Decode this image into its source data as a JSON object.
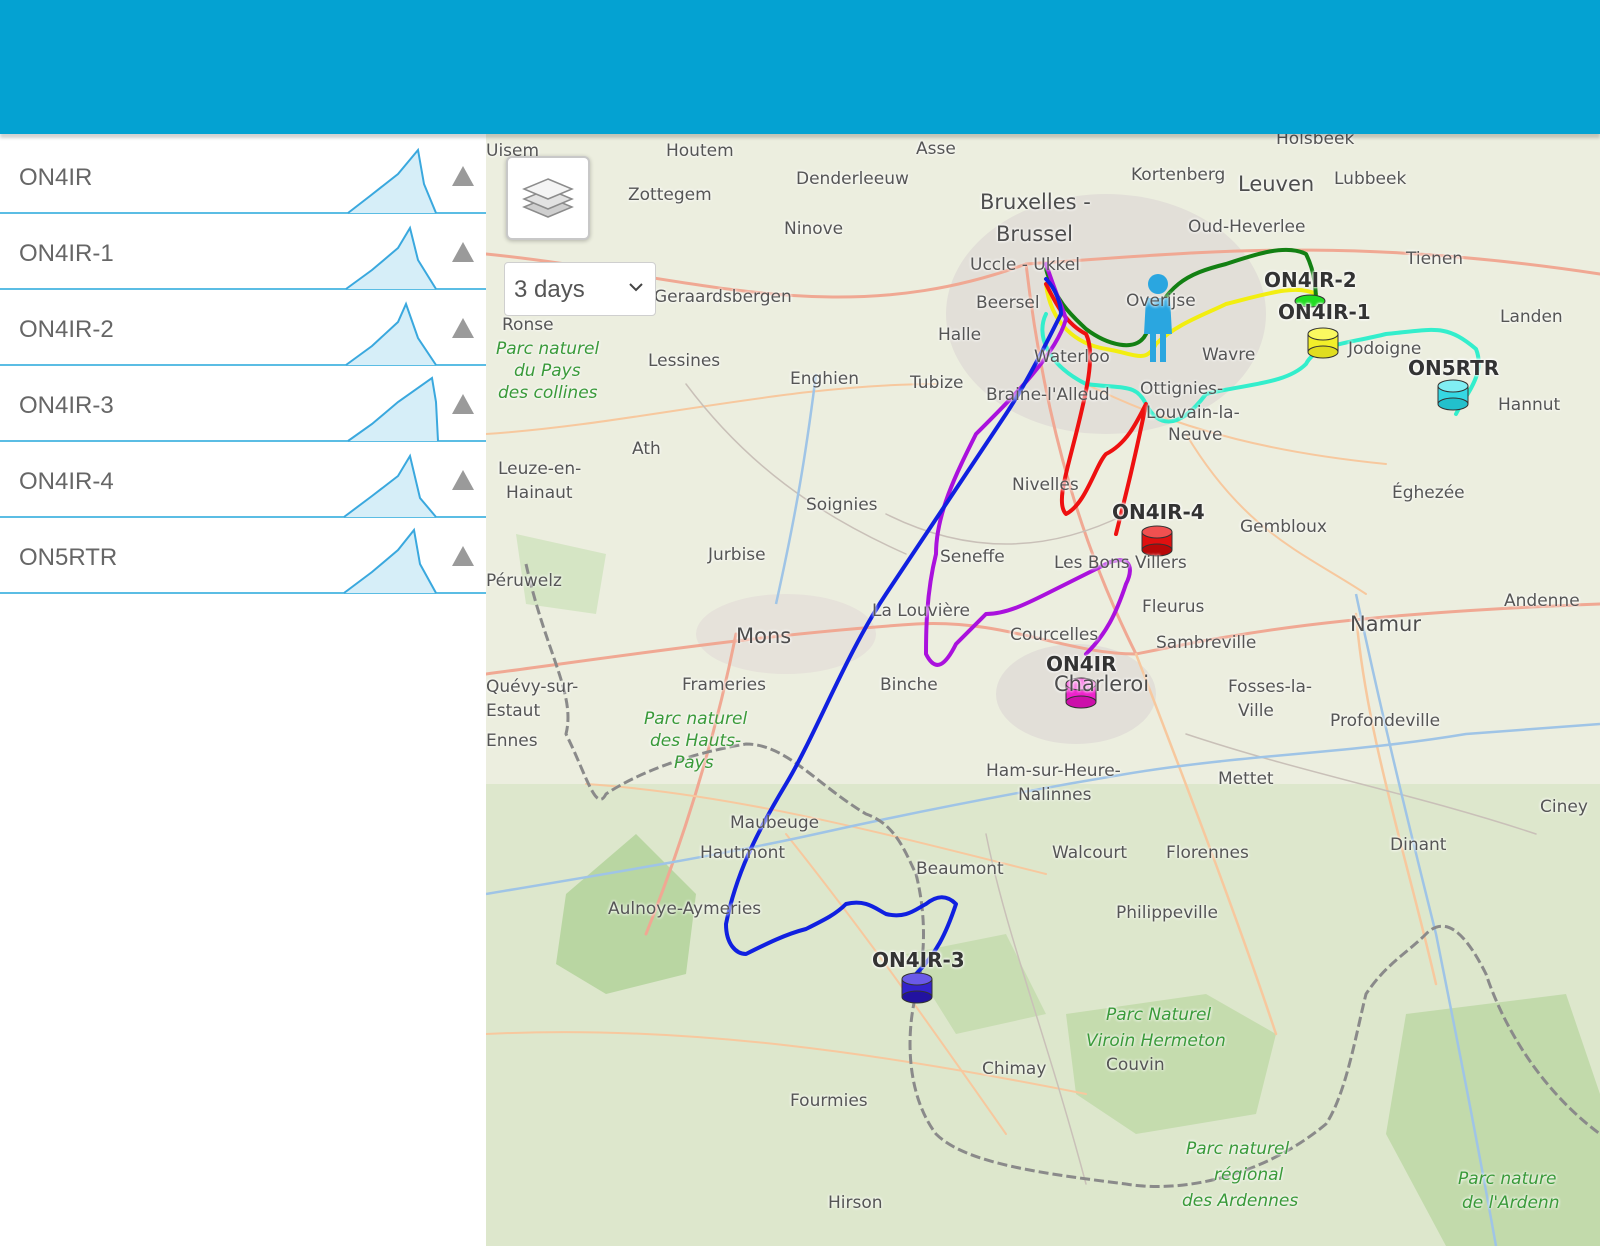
{
  "header": {
    "background": "#04a2d2"
  },
  "stations": [
    {
      "name": "ON4IR"
    },
    {
      "name": "ON4IR-1"
    },
    {
      "name": "ON4IR-2"
    },
    {
      "name": "ON4IR-3"
    },
    {
      "name": "ON4IR-4"
    },
    {
      "name": "ON5RTR"
    }
  ],
  "controls": {
    "layers_icon": "layers-icon",
    "range_value": "3 days",
    "range_chevron": "chevron-down-icon"
  },
  "markers": [
    {
      "label": "ON4IR-2",
      "color": "#22dd22"
    },
    {
      "label": "ON4IR-1",
      "color": "#f2ef2a"
    },
    {
      "label": "ON5RTR",
      "color": "#36d8e4"
    },
    {
      "label": "ON4IR-4",
      "color": "#e01010"
    },
    {
      "label": "ON4IR",
      "color": "#ee22cc"
    },
    {
      "label": "ON4IR-3",
      "color": "#3322cc"
    }
  ],
  "track_colors": {
    "ON4IR": "#aa11dd",
    "ON4IR-1": "#f0f000",
    "ON4IR-2": "#138013",
    "ON4IR-3": "#1020e0",
    "ON4IR-4": "#ee1010",
    "ON5RTR": "#33eecc"
  },
  "places": [
    "Houtem",
    "Asse",
    "Kortenberg",
    "Leuven",
    "Lubbeek",
    "Holsbeek",
    "Denderleeuw",
    "Zottegem",
    "Bruxelles -",
    "Brussel",
    "Oud-Heverlee",
    "Ninove",
    "Uccle - Ukkel",
    "Tienen",
    "Geraardsbergen",
    "Beersel",
    "Overijse",
    "Ronse",
    "Halle",
    "Wavre",
    "Jodoigne",
    "Landen",
    "Lessines",
    "Waterloo",
    "Enghien",
    "Tubize",
    "Braine-l'Alleud",
    "Ottignies-",
    "Louvain-la-",
    "Neuve",
    "Hannut",
    "Ath",
    "Leuze-en-",
    "Hainaut",
    "Nivelles",
    "Éghezée",
    "Soignies",
    "Gembloux",
    "Jurbise",
    "Seneffe",
    "Les Bons Villers",
    "Péruwelz",
    "Fleurus",
    "La Louvière",
    "Mons",
    "Courcelles",
    "Sambreville",
    "Namur",
    "Andenne",
    "Frameries",
    "Binche",
    "Charleroi",
    "Fosses-la-",
    "Ville",
    "Profondeville",
    "Ham-sur-Heure-",
    "Nalinnes",
    "Mettet",
    "Maubeuge",
    "Hautmont",
    "Walcourt",
    "Florennes",
    "Dinant",
    "Ciney",
    "Beaumont",
    "Aulnoye-Aymeries",
    "Philippeville",
    "Chimay",
    "Couvin",
    "Fourmies",
    "Hirson",
    "Quévy-sur-",
    "Estaut",
    "Ennes",
    "Uisem"
  ],
  "parks": [
    "Parc naturel",
    "du Pays",
    "des collines",
    "Parc naturel",
    "des Hauts-",
    "Pays",
    "Parc Naturel",
    "Viroin Hermeton",
    "Parc naturel",
    "régional",
    "des Ardennes",
    "Parc nature",
    "de l'Ardenn"
  ]
}
